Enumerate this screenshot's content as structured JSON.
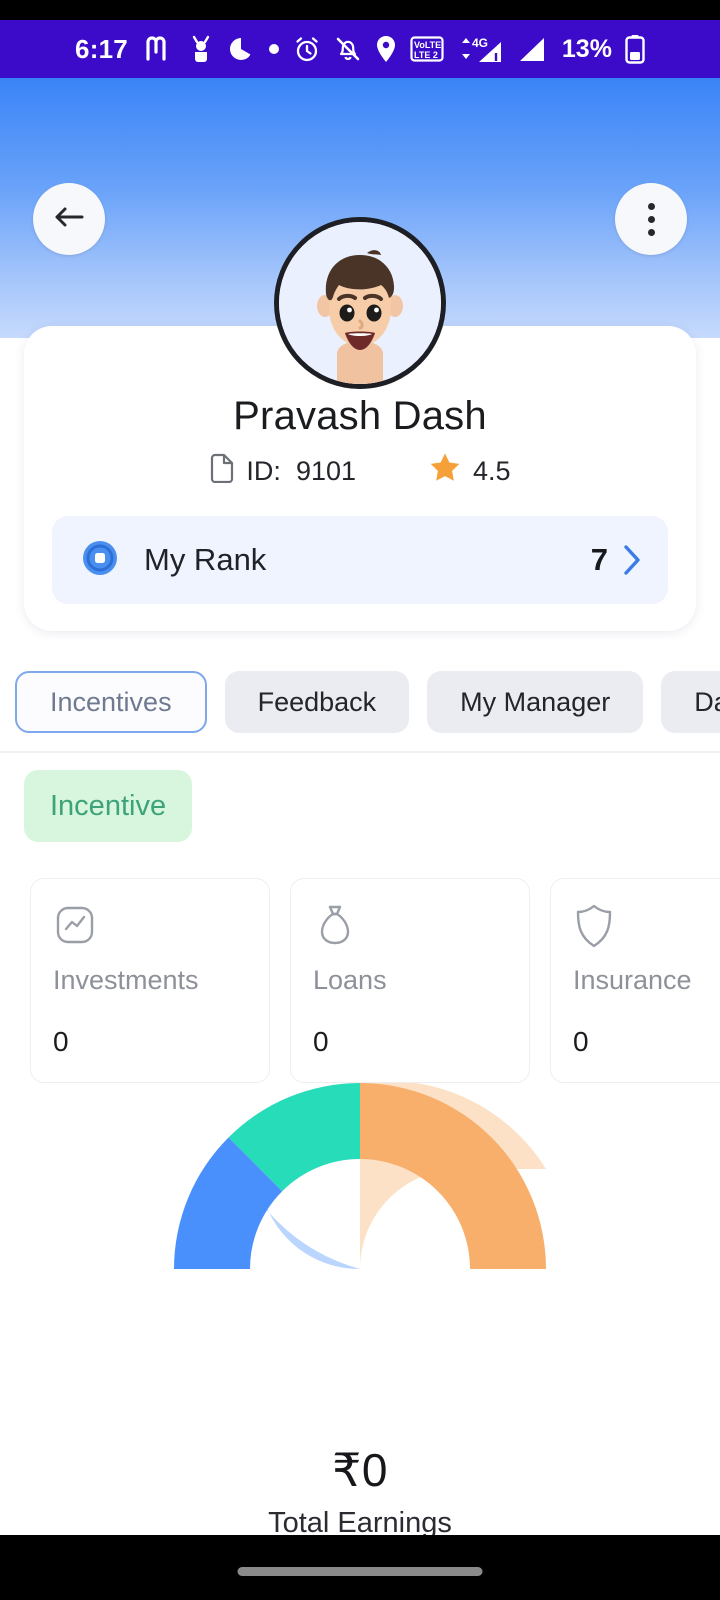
{
  "status_bar": {
    "time": "6:17",
    "battery_percent": "13%",
    "icons": [
      "metro-m-icon",
      "scooter-icon",
      "pacman-icon",
      "dot-icon",
      "alarm-clock-icon",
      "bell-muted-icon",
      "location-pin-icon",
      "volte-sim2-icon",
      "4g-signal-icon",
      "signal-bars-icon",
      "battery-icon"
    ]
  },
  "header": {
    "back_icon": "arrow-left-icon",
    "menu_icon": "overflow-menu-icon",
    "avatar_alt": "user-avatar-memoji"
  },
  "profile": {
    "name": "Pravash Dash",
    "id_label": "ID:",
    "id_value": "9101",
    "id_icon": "document-icon",
    "rating": "4.5",
    "rating_icon": "star-icon",
    "rank": {
      "icon": "rank-medal-icon",
      "label": "My Rank",
      "value": "7",
      "chevron": "chevron-right-icon"
    }
  },
  "tabs": [
    {
      "label": "Incentives",
      "active": true
    },
    {
      "label": "Feedback",
      "active": false
    },
    {
      "label": "My Manager",
      "active": false
    },
    {
      "label": "Da",
      "active": false
    }
  ],
  "incentive": {
    "badge": "Incentive",
    "stats": [
      {
        "icon": "chart-line-icon",
        "label": "Investments",
        "value": "0"
      },
      {
        "icon": "money-bag-icon",
        "label": "Loans",
        "value": "0"
      },
      {
        "icon": "shield-icon",
        "label": "Insurance",
        "value": "0"
      }
    ],
    "total_earnings_amount": "₹0",
    "total_earnings_caption": "Total Earnings"
  },
  "chart_data": {
    "type": "pie",
    "title": "",
    "subtitle": "Total Earnings",
    "variant": "half-donut-gauge",
    "start_angle": 180,
    "end_angle": 360,
    "categories": [
      "Investments",
      "Loans",
      "Insurance"
    ],
    "values": [
      50,
      25,
      25
    ],
    "units": "percent",
    "colors": [
      "#F7AF6B",
      "#27DCB8",
      "#4A90FC"
    ],
    "center_value": "₹0",
    "center_label": "Total Earnings",
    "legend": "none",
    "grid": false
  },
  "colors": {
    "status_bar_bg": "#3B0BC9",
    "header_gradient_top": "#3A84F7",
    "header_gradient_bottom": "#C6DAFC",
    "accent_blue": "#4A90FC",
    "gauge_orange": "#F7AF6B",
    "gauge_teal": "#27DCB8",
    "badge_green_bg": "#D8F6DD",
    "badge_green_text": "#3DA37A",
    "rank_row_bg": "#EFF4FE",
    "tab_inactive_bg": "#EAECF1",
    "tab_active_border": "#7FA8EC"
  }
}
